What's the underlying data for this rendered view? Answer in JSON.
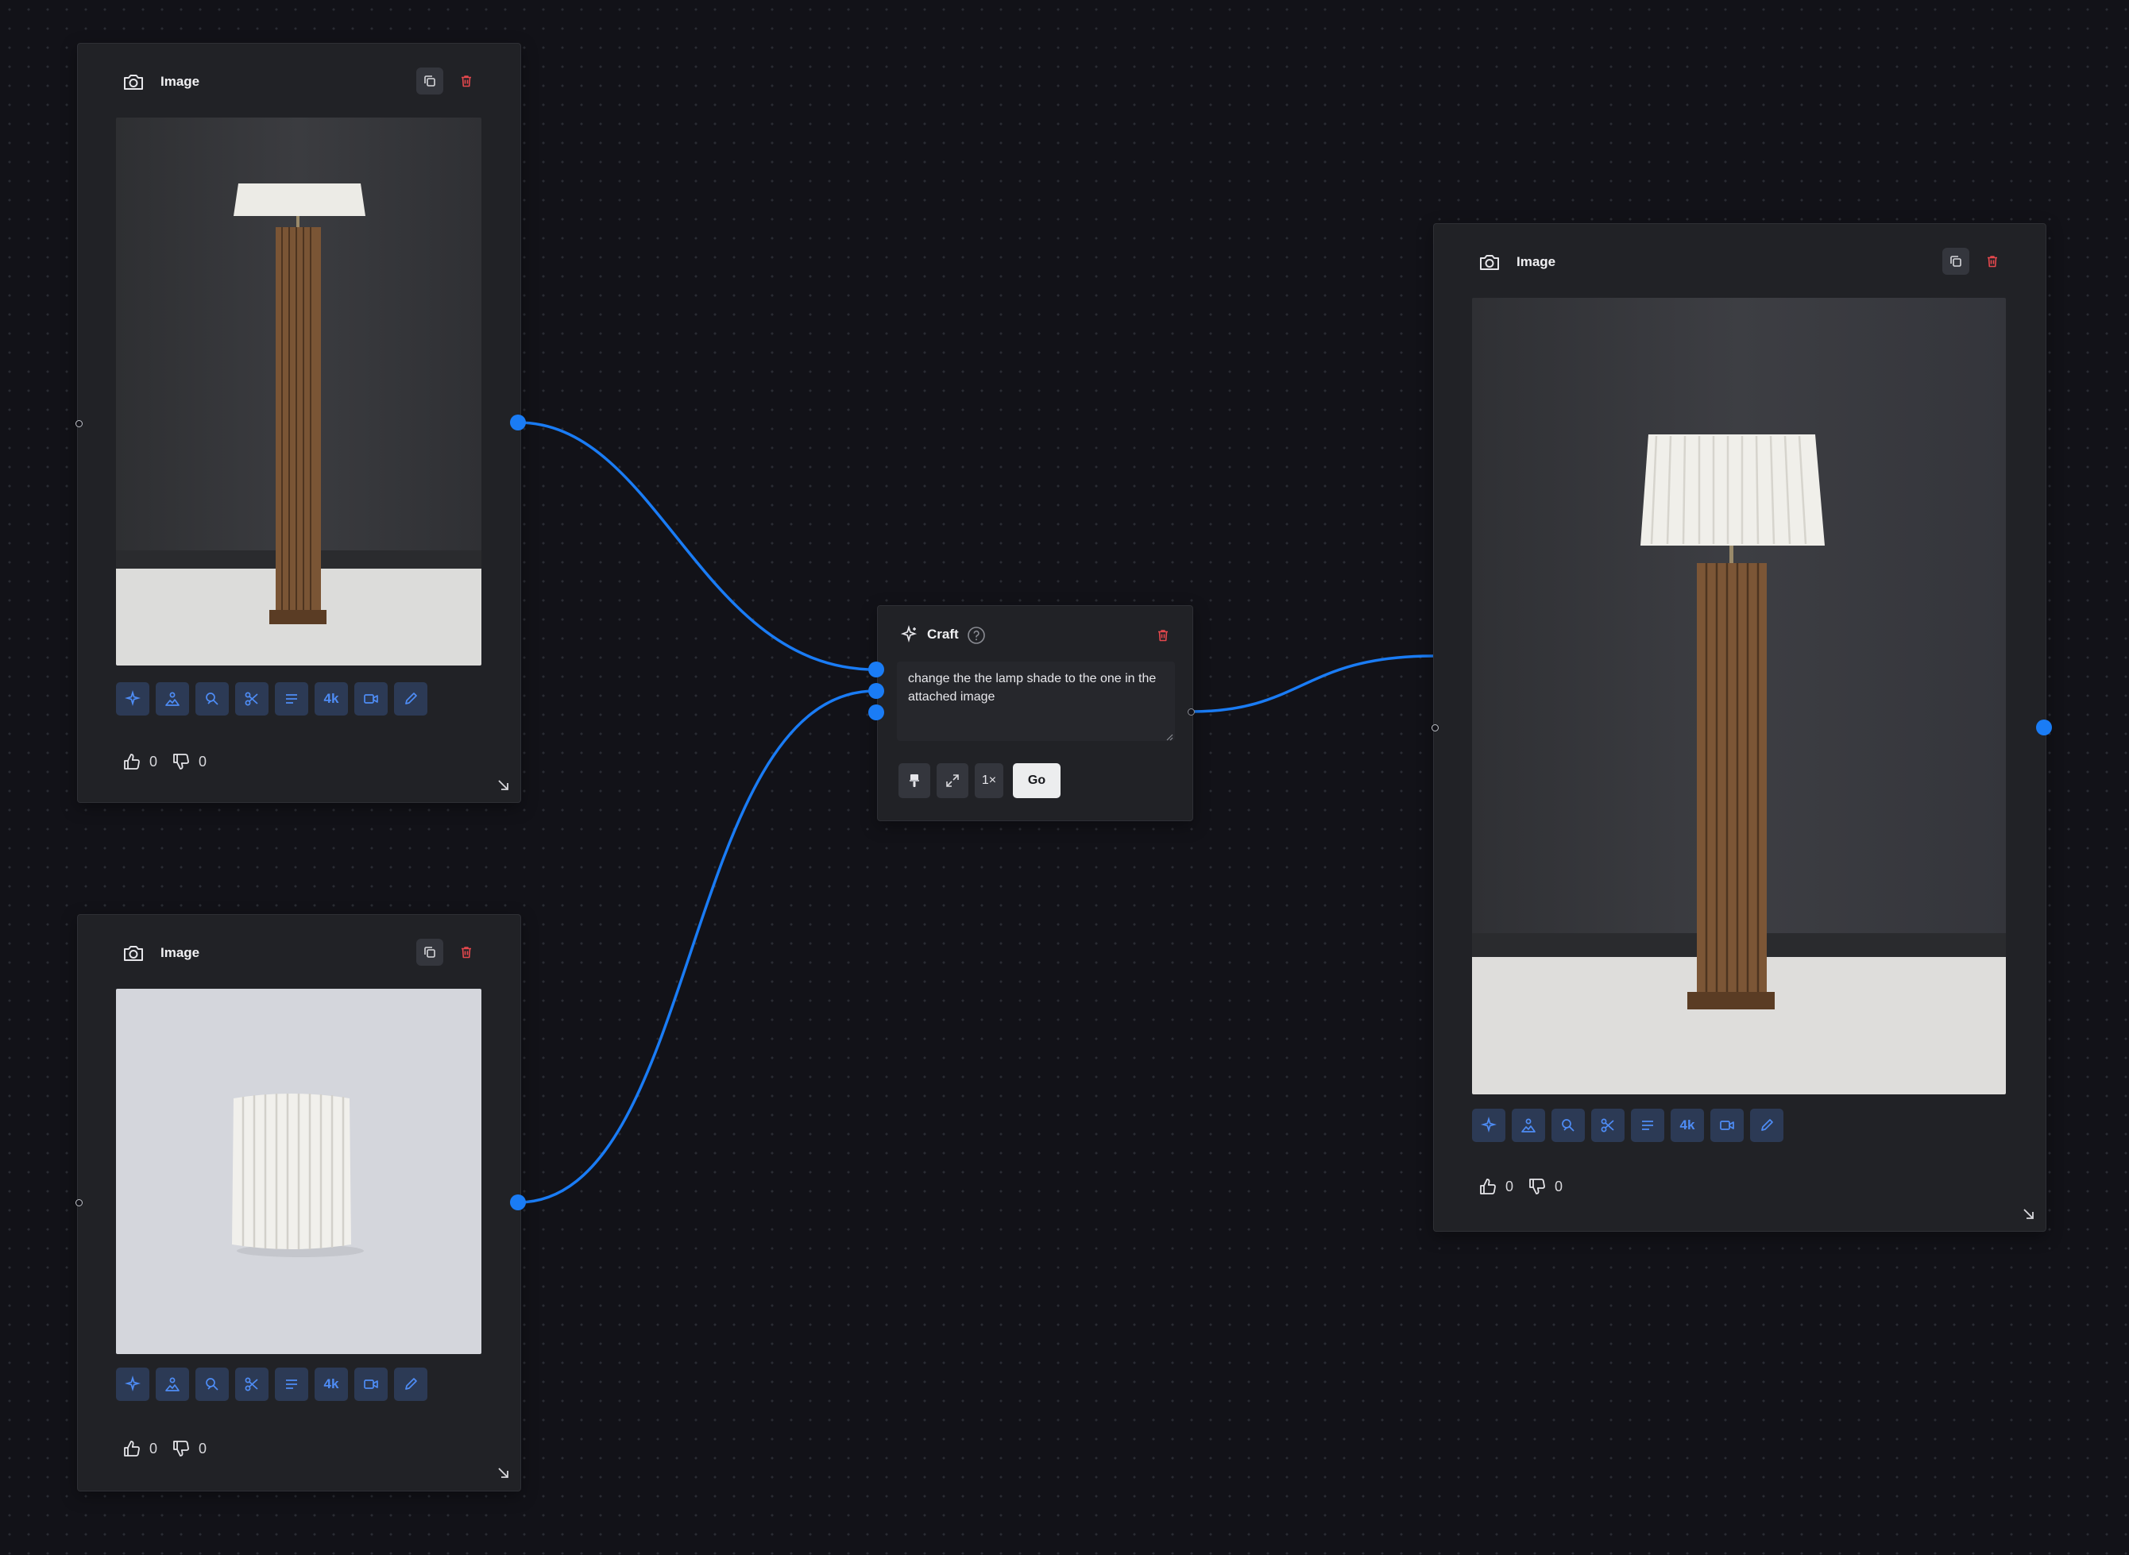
{
  "nodes": {
    "image_top": {
      "title": "Image",
      "likes": "0",
      "dislikes": "0"
    },
    "image_bottom": {
      "title": "Image",
      "likes": "0",
      "dislikes": "0"
    },
    "image_output": {
      "title": "Image",
      "likes": "0",
      "dislikes": "0"
    },
    "craft": {
      "title": "Craft",
      "prompt": "change the the lamp shade to the one in the attached image",
      "multiplier_label": "1×",
      "go_label": "Go"
    }
  },
  "toolbar": {
    "tools": [
      "sparkle-icon",
      "image-person-icon",
      "recolor-icon",
      "scissors-icon",
      "text-lines-icon",
      "4k",
      "video-icon",
      "pencil-icon"
    ],
    "upscale_label": "4k"
  },
  "colors": {
    "accent": "#1a7cf5",
    "tool_icon": "#4e8cf5",
    "tool_bg": "#2c3a55",
    "card_bg": "#212226",
    "canvas_bg": "#121218",
    "delete": "#e5484d"
  }
}
